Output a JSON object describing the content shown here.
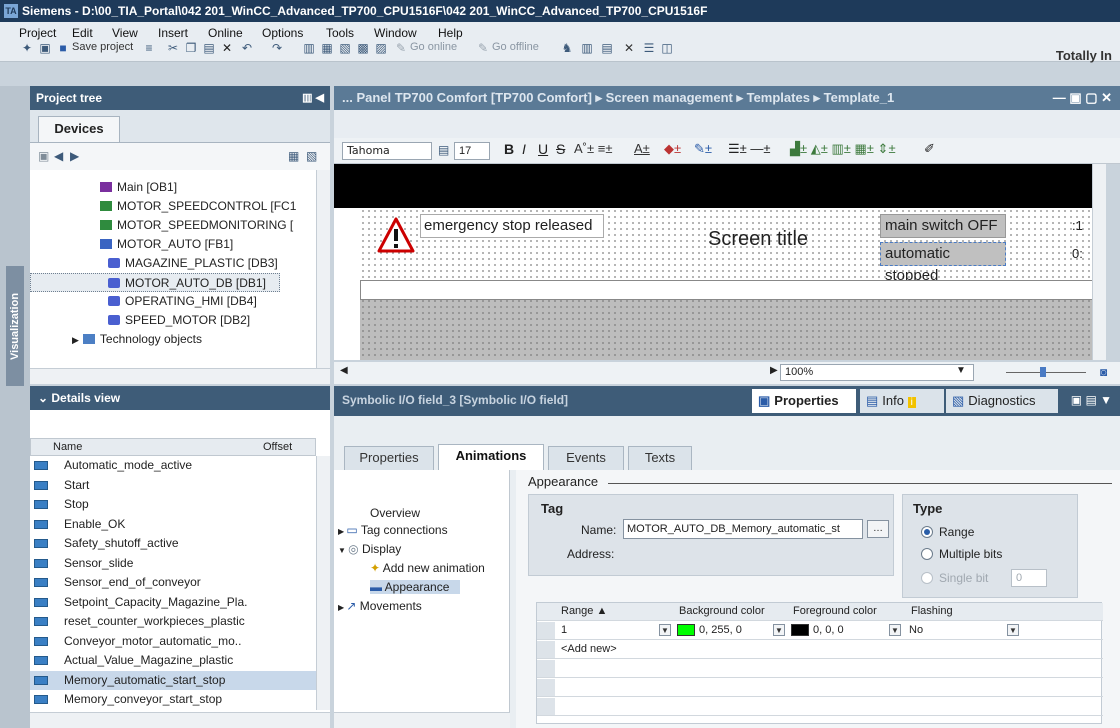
{
  "titlebar": {
    "title": "Siemens - D:\\00_TIA_Portal\\042 201_WinCC_Advanced_TP700_CPU1516F\\042 201_WinCC_Advanced_TP700_CPU1516F",
    "logo": "TA"
  },
  "menu": [
    "Project",
    "Edit",
    "View",
    "Insert",
    "Online",
    "Options",
    "Tools",
    "Window",
    "Help"
  ],
  "brand": "Totally In",
  "toolbar": {
    "save_label": "Save project",
    "go_online": "Go online",
    "go_offline": "Go offline"
  },
  "sidebar": {
    "visualization_label": "Visualization"
  },
  "project_tree": {
    "title": "Project tree",
    "tab": "Devices",
    "items": [
      {
        "label": "Main [OB1]",
        "icon": "ob-icon"
      },
      {
        "label": "MOTOR_SPEEDCONTROL [FC1",
        "icon": "fc-icon"
      },
      {
        "label": "MOTOR_SPEEDMONITORING [",
        "icon": "fc-icon"
      },
      {
        "label": "MOTOR_AUTO [FB1]",
        "icon": "fb-icon"
      },
      {
        "label": "MAGAZINE_PLASTIC [DB3]",
        "icon": "db-icon"
      },
      {
        "label": "MOTOR_AUTO_DB [DB1]",
        "icon": "db-icon"
      },
      {
        "label": "OPERATING_HMI [DB4]",
        "icon": "db-icon"
      },
      {
        "label": "SPEED_MOTOR [DB2]",
        "icon": "db-icon"
      },
      {
        "label": "Technology objects",
        "icon": "technology-icon"
      }
    ]
  },
  "details_view": {
    "title": "Details view",
    "col_name": "Name",
    "col_offset": "Offset",
    "rows": [
      "Automatic_mode_active",
      "Start",
      "Stop",
      "Enable_OK",
      "Safety_shutoff_active",
      "Sensor_slide",
      "Sensor_end_of_conveyor",
      "Setpoint_Capacity_Magazine_Pla.",
      "reset_counter_workpieces_plastic",
      "Conveyor_motor_automatic_mo..",
      "Actual_Value_Magazine_plastic",
      "Memory_automatic_start_stop",
      "Memory_conveyor_start_stop"
    ]
  },
  "editor": {
    "breadcrumb": "... Panel TP700 Comfort [TP700 Comfort] ▸ Screen management ▸ Templates ▸ Template_1",
    "font": "Tahoma",
    "font_size": "17",
    "screen": {
      "emergency_text": "emergency stop released",
      "title": "Screen title",
      "main_switch": "main switch OFF",
      "automatic": "automatic stopped",
      "clock_top": ":1",
      "clock_bottom": "0:"
    },
    "zoom": "100%"
  },
  "inspector": {
    "title": "Symbolic I/O field_3 [Symbolic I/O field]",
    "header_tabs": [
      "Properties",
      "Info",
      "Diagnostics"
    ],
    "tabs": [
      "Properties",
      "Animations",
      "Events",
      "Texts"
    ],
    "active_tab": "Animations",
    "nav": [
      "Overview",
      "Tag connections",
      "Display",
      "Add new animation",
      "Appearance",
      "Movements"
    ],
    "section_title": "Appearance",
    "tag": {
      "label": "Tag",
      "name_label": "Name:",
      "name_value": "MOTOR_AUTO_DB_Memory_automatic_st",
      "address_label": "Address:"
    },
    "type": {
      "label": "Type",
      "options": [
        "Range",
        "Multiple bits",
        "Single bit"
      ],
      "single_bit_value": "0"
    },
    "grid": {
      "headers": [
        "Range ▲",
        "Background color",
        "Foreground color",
        "Flashing"
      ],
      "rows": [
        {
          "range": "1",
          "bg": "0, 255, 0",
          "fg": "0, 0, 0",
          "flashing": "No"
        }
      ],
      "add_new": "<Add new>"
    }
  },
  "colors": {
    "bg_green": "#00ff00",
    "fg_black": "#000000"
  }
}
